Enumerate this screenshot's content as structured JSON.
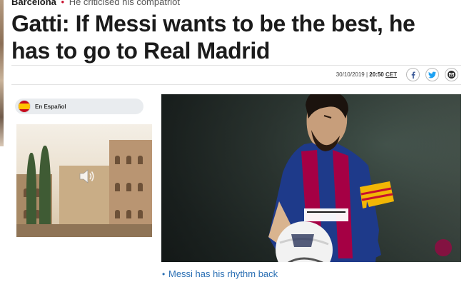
{
  "article": {
    "section": "Barcelona",
    "separator": "•",
    "subtitle": "He criticised his compatriot",
    "headline": "Gatti: If Messi wants to be the best, he has to go to Real Madrid",
    "date": "30/10/2019",
    "divider": "|",
    "time": "20:50",
    "timezone": "CET"
  },
  "share": [
    {
      "icon": "facebook-icon",
      "color": "#3b5998"
    },
    {
      "icon": "twitter-icon",
      "color": "#1da1f2"
    },
    {
      "icon": "email-icon",
      "color": "#333333"
    }
  ],
  "language": {
    "label": "En Español",
    "flag": "spain-flag-icon"
  },
  "video": {
    "icon": "speaker-icon"
  },
  "hero": {
    "alt_subject": "player-with-ball"
  },
  "related": {
    "bullet": "•",
    "link": "Messi has his rhythm back"
  },
  "colors": {
    "accent_red": "#c8102e",
    "link_blue": "#2a6fb4"
  }
}
